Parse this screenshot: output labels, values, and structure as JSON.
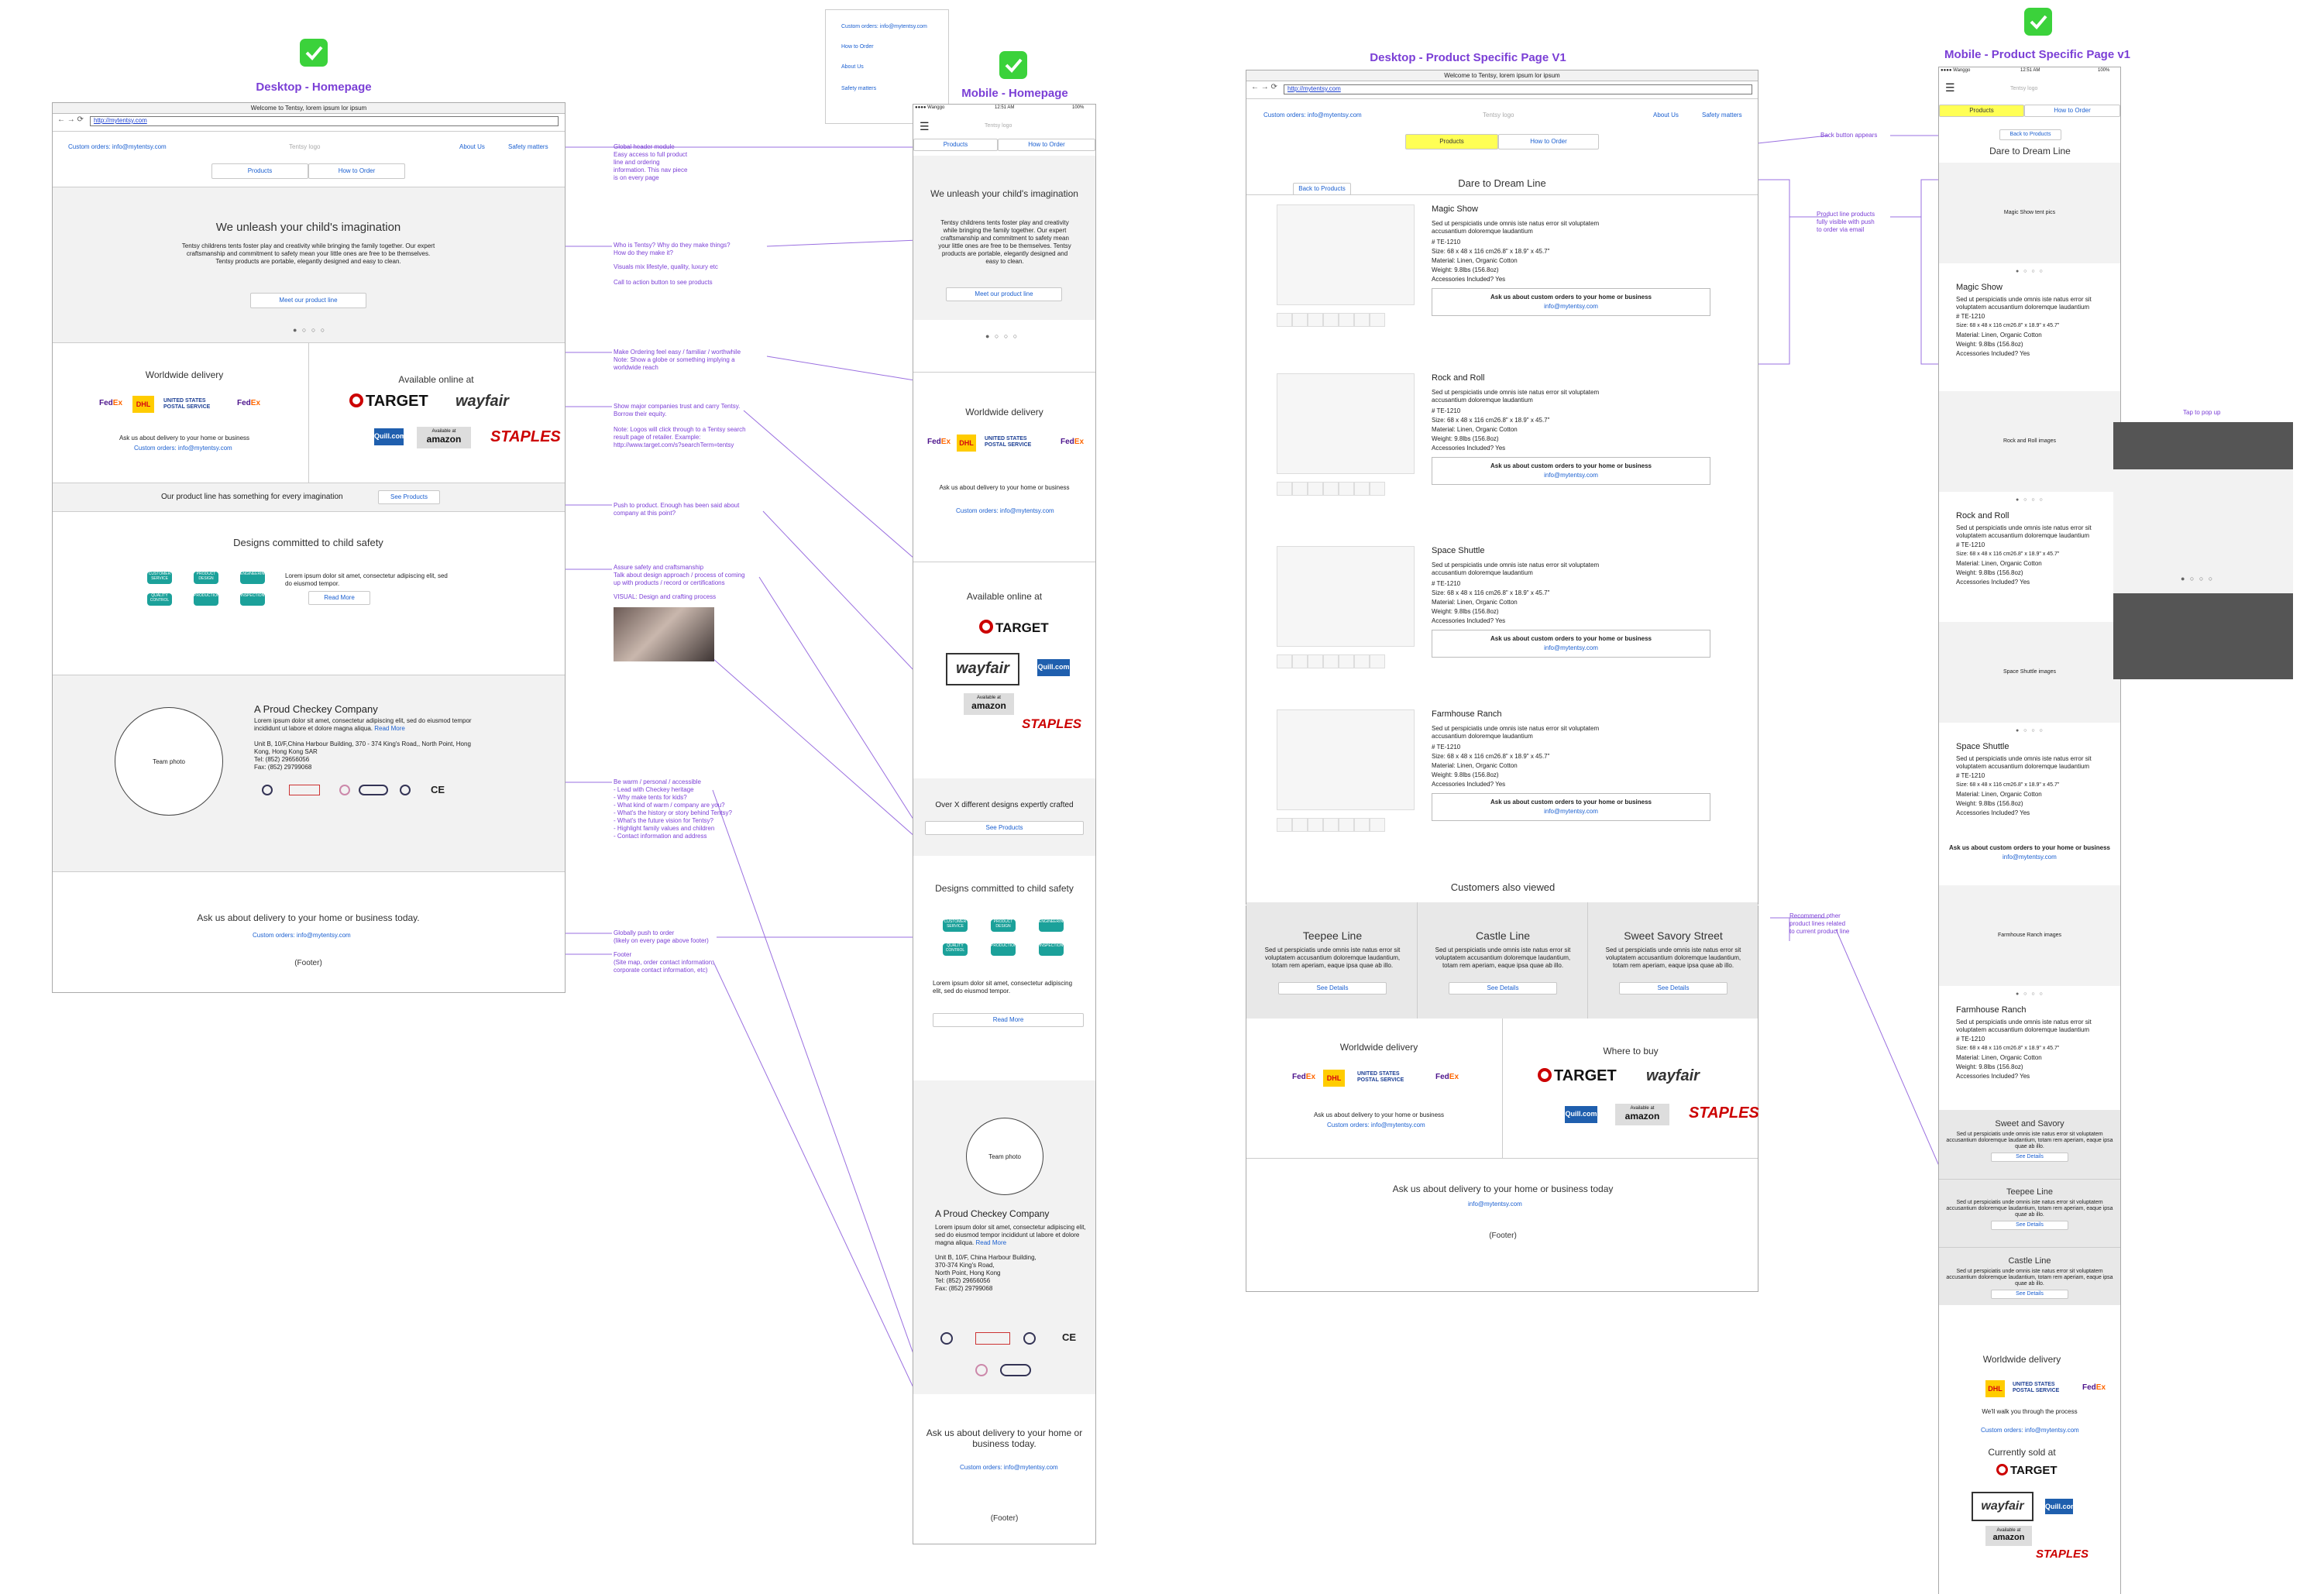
{
  "titles": {
    "desktop_home": "Desktop - Homepage",
    "mobile_home": "Mobile - Homepage",
    "desktop_product": "Desktop - Product Specific Page V1",
    "mobile_product": "Mobile - Product Specific Page v1"
  },
  "browser": {
    "welcome": "Welcome to Tentsy, lorem ipsum lor ipsum",
    "url": "http://mytentsy.com"
  },
  "header": {
    "custom_orders": "Custom orders: info@mytentsy.com",
    "logo": "Tentsy logo",
    "about": "About Us",
    "safety": "Safety matters",
    "products": "Products",
    "how_to_order": "How to Order"
  },
  "mobile_status": {
    "carrier": "●●●● Wanggo",
    "time": "12:51 AM",
    "battery": "100%"
  },
  "menu_popup": [
    "Custom orders: info@mytentsy.com",
    "How to Order",
    "About Us",
    "Safety matters"
  ],
  "hero": {
    "title": "We unleash your child's imagination",
    "body": "Tentsy childrens tents foster play and creativity while bringing the family together. Our expert craftsmanship and commitment to safety mean your little ones are free to be themselves. Tentsy products are portable, elegantly designed and easy to clean.",
    "cta": "Meet our product line",
    "dots": "● ○ ○ ○"
  },
  "delivery": {
    "title": "Worldwide delivery",
    "ask": "Ask us about delivery to your home or business",
    "email": "Custom orders: info@mytentsy.com",
    "walk": "We'll walk you through the process"
  },
  "carriers": {
    "fedex_a": "Fed",
    "fedex_b": "Ex",
    "dhl": "DHL",
    "usps": "UNITED STATES POSTAL SERVICE"
  },
  "retail": {
    "title": "Available online at",
    "where": "Where to buy",
    "sold": "Currently sold at",
    "target": "TARGET",
    "wayfair": "wayfair",
    "quill": "Quill.com",
    "amazon_small": "Available at",
    "amazon": "amazon",
    "staples": "STAPLES"
  },
  "product_strip": {
    "text": "Our product line has something for every imagination",
    "mobile_text": "Over X different designs expertly crafted",
    "button": "See Products"
  },
  "safety_sec": {
    "title": "Designs committed to child safety",
    "body": "Lorem ipsum dolor sit amet, consectetur adipiscing elit, sed do eiusmod tempor.",
    "button": "Read More",
    "pills": [
      "CUSTOMER SERVICE",
      "PRODUCT DESIGN",
      "ENGINEERING",
      "QUALITY CONTROL",
      "PRODUCTION",
      "INSPECTION"
    ]
  },
  "company": {
    "photo": "Team photo",
    "title": "A Proud Checkey Company",
    "body": "Lorem ipsum dolor sit amet, consectetur adipiscing elit, sed do eiusmod tempor incididunt ut labore et dolore magna aliqua.",
    "read_more": "Read More",
    "addr1": "Unit B, 10/F,China Harbour Building, 370 - 374 King's Road,, North Point, Hong Kong, Hong Kong SAR",
    "tel": "Tel: (852) 29656056",
    "fax": "Fax: (852) 29799068",
    "m_addr": [
      "Unit B, 10/F, China Harbour Building,",
      "370-374 King's Road,",
      "North Point, Hong Kong",
      "Tel: (852) 29656056",
      "Fax: (852) 29799068"
    ]
  },
  "bottom": {
    "ask": "Ask us about delivery to your home or business today.",
    "ask2": "Ask us about delivery to your home or business today",
    "footer": "(Footer)"
  },
  "product_page": {
    "line_title": "Dare to Dream Line",
    "back": "Back to Products",
    "desc": "Sed ut perspiciatis unde omnis iste natus error sit voluptatem accusantium doloremque laudantium",
    "sku": "# TE-1210",
    "size": "Size: 68 x 48 x 116 cm26.8\" x 18.9\" x 45.7\"",
    "material": "Material: Linen, Organic Cotton",
    "weight": "Weight: 9.8lbs (156.8oz)",
    "acc": "Accessories Included? Yes",
    "ask": "Ask us about custom orders to your home or business",
    "email": "info@mytentsy.com",
    "products": [
      "Magic Show",
      "Rock and Roll",
      "Space Shuttle",
      "Farmhouse Ranch"
    ],
    "mobile_imgs": [
      "Magic Show tent pics",
      "Rock and Roll images",
      "Space Shuttle images",
      "Farmhouse Ranch images"
    ],
    "also": "Customers also viewed",
    "lines": [
      {
        "name": "Teepee Line",
        "desc": "Sed ut perspiciatis unde omnis iste natus error sit voluptatem accusantium doloremque laudantium, totam rem aperiam, eaque ipsa quae ab illo."
      },
      {
        "name": "Castle Line",
        "desc": "Sed ut perspiciatis unde omnis iste natus error sit voluptatem accusantium doloremque laudantium, totam rem aperiam, eaque ipsa quae ab illo."
      },
      {
        "name": "Sweet Savory Street",
        "desc": "Sed ut perspiciatis unde omnis iste natus error sit voluptatem accusantium doloremque laudantium, totam rem aperiam, eaque ipsa quae ab illo."
      }
    ],
    "m_lines": [
      "Sweet and Savory",
      "Teepee Line",
      "Castle Line"
    ],
    "see_details": "See Details"
  },
  "popup_label": "Tap to pop up",
  "notes": {
    "n1": [
      "Global header module",
      "Easy access to full product",
      "line and ordering",
      "information. This nav piece",
      "is on every page"
    ],
    "n2": [
      "Who is Tentsy? Why do they make things?",
      "How do they make it?"
    ],
    "n3": [
      "Visuals mix lifestyle, quality, luxury etc"
    ],
    "n4": [
      "Call to action button to see products"
    ],
    "n5": [
      "Make Ordering feel easy / familiar / worthwhile",
      "Note: Show a globe or something implying a",
      "worldwide reach"
    ],
    "n6": [
      "Show major companies trust and carry Tentsy.",
      "Borrow their equity."
    ],
    "n7": [
      "Note: Logos will click through to a Tentsy search",
      "result page of retailer. Example:",
      "http://www.target.com/s?searchTerm=tentsy"
    ],
    "n8": [
      "Push to product. Enough has been said about",
      "company at this point?"
    ],
    "n9": [
      "Assure safety and craftsmanship",
      "Talk about design approach / process of coming",
      "up with products / record or certifications"
    ],
    "n10": [
      "VISUAL: Design and crafting process"
    ],
    "n11": [
      "Be warm / personal / accessible",
      "- Lead with Checkey heritage",
      "- Why make tents for kids?",
      "- What kind of warm / company are you?",
      "- What's the history or story behind Tentsy?",
      "- What's the future vision for Tentsy?",
      "- Highlight family values and children",
      "- Contact information and address"
    ],
    "n12": [
      "Globally push to order",
      "(likely on every page above footer)"
    ],
    "n13": [
      "Footer",
      "(Site map, order contact information,",
      "corporate contact information, etc)"
    ],
    "n14": [
      "Back button appears"
    ],
    "n15": [
      "Product line products",
      "fully visible with push",
      "to order via email"
    ],
    "n16": [
      "Recommend other",
      "product lines related",
      "to current product line"
    ]
  }
}
